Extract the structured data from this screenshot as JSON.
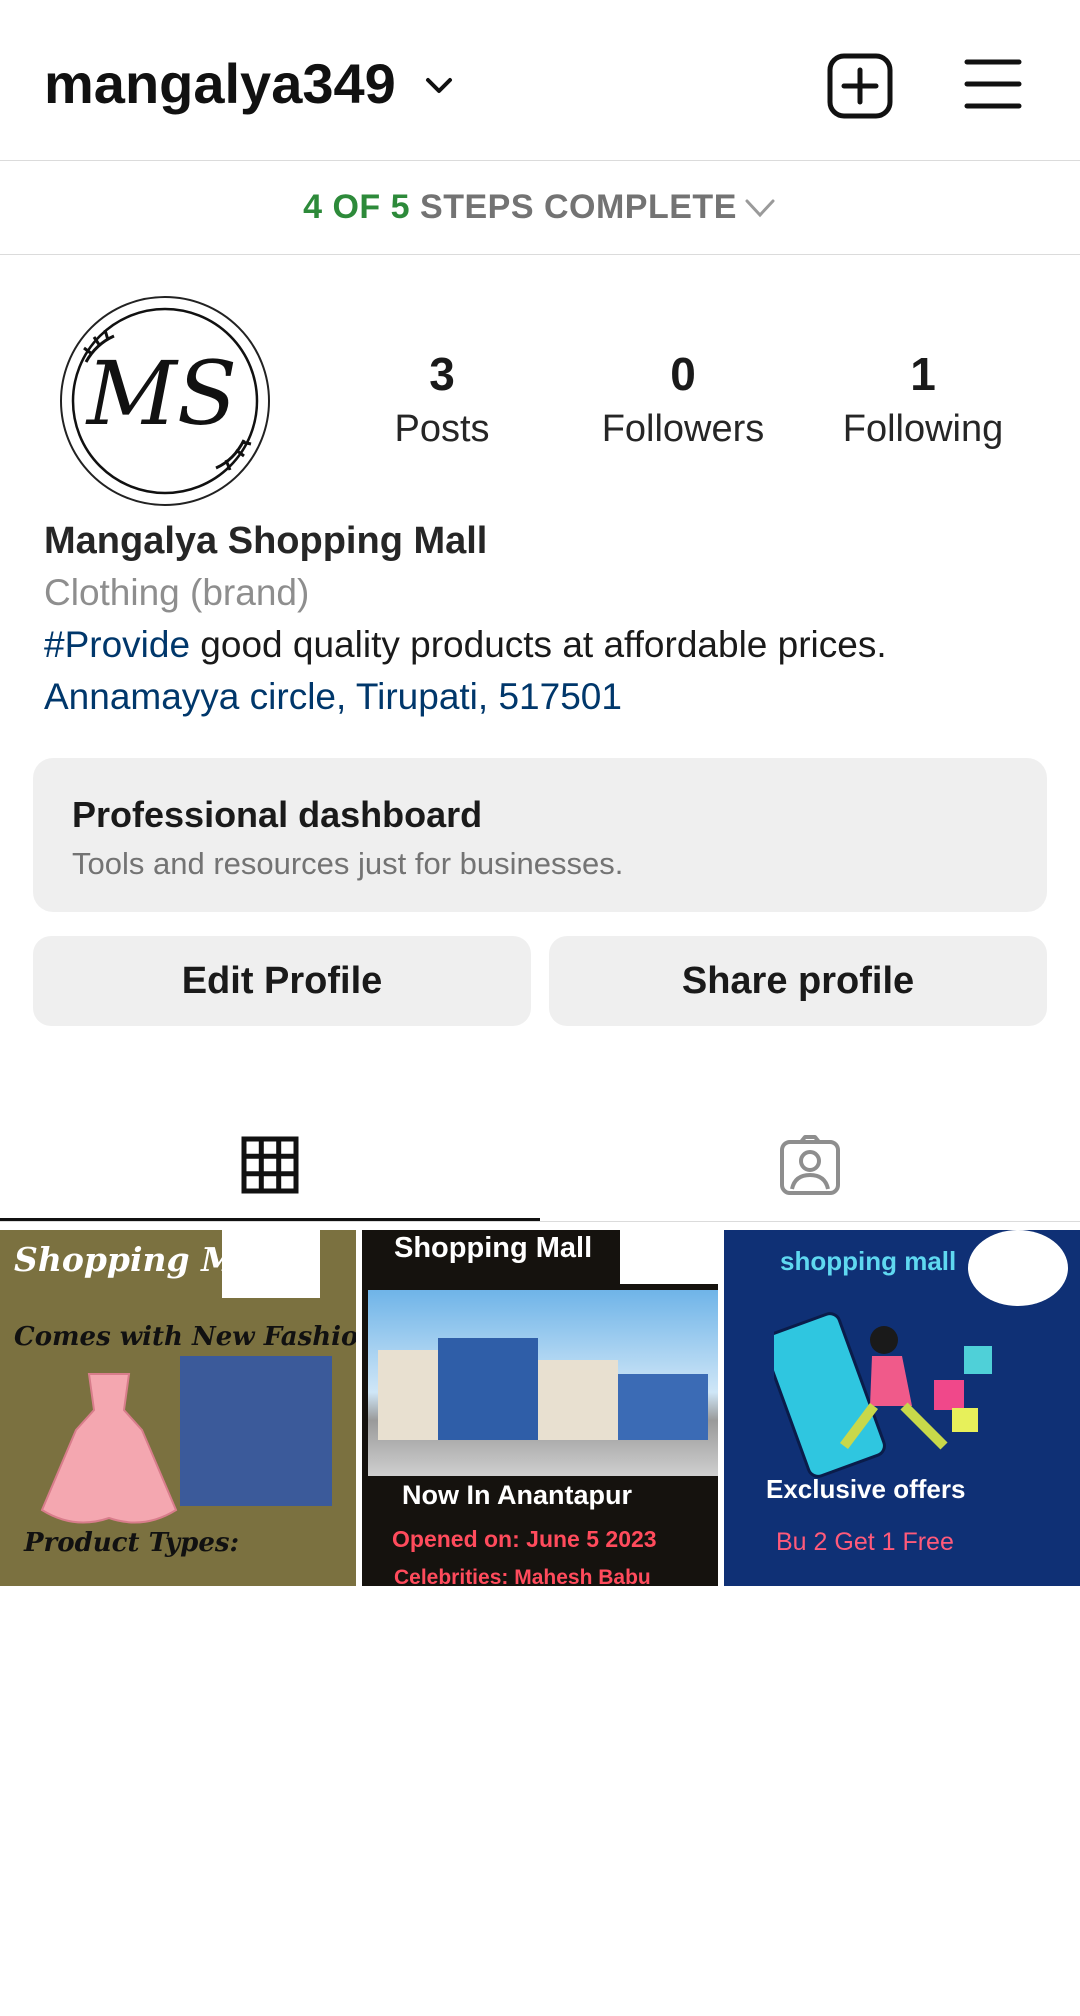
{
  "header": {
    "username": "mangalya349",
    "icons": [
      "chevron-down-icon",
      "add-square-icon",
      "menu-icon"
    ]
  },
  "steps": {
    "done": "4 OF 5",
    "rest": "STEPS COMPLETE"
  },
  "profile": {
    "avatar_text": "MS",
    "stats": [
      {
        "value": "3",
        "label": "Posts"
      },
      {
        "value": "0",
        "label": "Followers"
      },
      {
        "value": "1",
        "label": "Following"
      }
    ],
    "name": "Mangalya Shopping Mall",
    "category": "Clothing (brand)",
    "bio_tag": "#Provide",
    "bio_text": " good quality products at affordable prices.",
    "address": "Annamayya circle, Tirupati, 517501"
  },
  "dashboard": {
    "title": "Professional dashboard",
    "subtitle": "Tools and resources just for businesses."
  },
  "actions": {
    "edit": "Edit Profile",
    "share": "Share profile"
  },
  "tabs": [
    "grid-icon",
    "tagged-icon"
  ],
  "posts": [
    {
      "title": "Shopping Mall",
      "line2": "Comes with New Fashion",
      "line3": "Product Types:",
      "bg": "#7b7140"
    },
    {
      "title": "Shopping Mall",
      "line2": "Now In Anantapur",
      "line3": "Opened on: June 5  2023",
      "line4": "Celebrities: Mahesh Babu",
      "bg": "#15120e"
    },
    {
      "title": "shopping mall",
      "line2": "Exclusive offers",
      "line3": "Bu  2 Get 1 Free",
      "bg": "#0f3075"
    }
  ],
  "colors": {
    "steps_done": "#2d8a3a",
    "link": "#00376b",
    "button_bg": "#efefef"
  }
}
